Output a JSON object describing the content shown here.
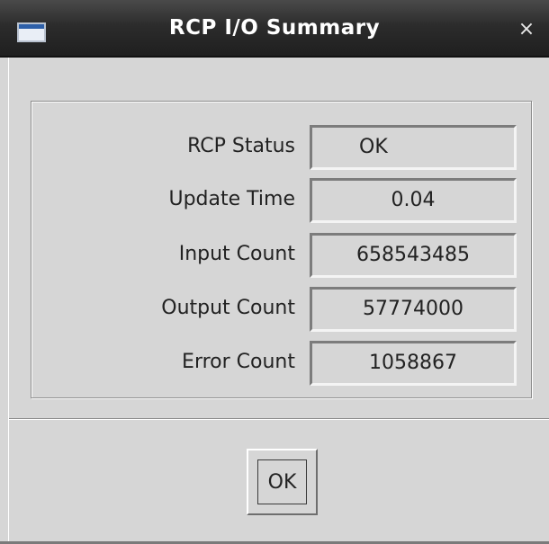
{
  "window": {
    "title": "RCP I/O Summary",
    "close_glyph": "×",
    "icon": "window-icon",
    "accent_color": "#2d5fa8"
  },
  "rows": [
    {
      "label": "RCP Status",
      "value": "OK"
    },
    {
      "label": "Update Time",
      "value": "0.04"
    },
    {
      "label": "Input Count",
      "value": "658543485"
    },
    {
      "label": "Output Count",
      "value": "57774000"
    },
    {
      "label": "Error Count",
      "value": "1058867"
    }
  ],
  "buttons": {
    "ok_label": "OK"
  }
}
